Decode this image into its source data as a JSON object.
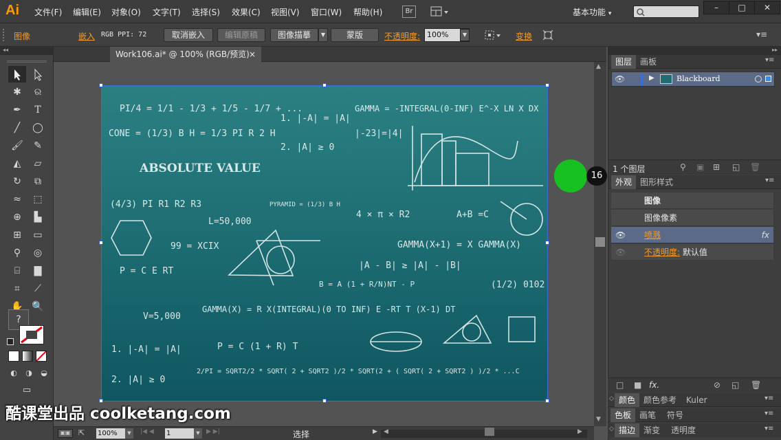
{
  "app": {
    "logo": "Ai",
    "menu": [
      "文件(F)",
      "编辑(E)",
      "对象(O)",
      "文字(T)",
      "选择(S)",
      "效果(C)",
      "视图(V)",
      "窗口(W)",
      "帮助(H)"
    ],
    "bridge_label": "Br",
    "workspace_label": "基本功能",
    "window_buttons": [
      "–",
      "□",
      "✕"
    ]
  },
  "control_bar": {
    "selection_type": "图像",
    "embed_label": "嵌入",
    "color_info": "RGB  PPI: 72",
    "unembed_button": "取消嵌入",
    "edit_original_button": "编辑原稿",
    "image_trace_button": "图像描摹",
    "mask_button": "蒙版",
    "opacity_label": "不透明度:",
    "opacity_value": "100%",
    "transform_label": "变换"
  },
  "document": {
    "tab_title": "Work106.ai* @ 100% (RGB/预览)",
    "tab_close": "×"
  },
  "artboard_text": {
    "l1": "PI/4 = 1/1 - 1/3 + 1/5 - 1/7 + ...",
    "l2": "1.  |-A| = |A|",
    "l3": "GAMMA = -INTEGRAL(0-INF) E^-X LN X DX",
    "l4": "CONE = (1/3) B H = 1/3 PI R 2 H",
    "l5": "|-23|=|4|",
    "l6": "2.  |A| ≥ 0",
    "l7": "ABSOLUTE VALUE",
    "l8": "(4/3) PI R1 R2 R3",
    "l9": "PYRAMID = (1/3) B H",
    "l10": "L=50,000",
    "l11": "4 × π × R2",
    "l12": "A+B =C",
    "l13": "99 = XCIX",
    "l14": "GAMMA(X+1) = X GAMMA(X)",
    "l15": "P = C E RT",
    "l16": "|A - B| ≥ |A| - |B|",
    "l17": "B = A (1 + R/N)NT - P",
    "l18": "(1/2) 0102",
    "l19": "V=5,000",
    "l20": "GAMMA(X) = R X(INTEGRAL)(0 TO INF) E -RT T (X-1) DT",
    "l21": "1.  |-A| = |A|",
    "l22": "P = C (1 + R) T",
    "l23": "2.  |A| ≥ 0",
    "l24": "2/PI = SQRT2/2 * SQRT( 2 + SQRT2 )/2 * SQRT(2 + ( SQRT( 2 + SQRT2 ) )/2 * ...C"
  },
  "status_bar": {
    "zoom": "100%",
    "page": "1",
    "tool_status": "选择"
  },
  "overlay": {
    "step_number": "16",
    "watermark": "酷课堂出品 coolketang.com"
  },
  "layers_panel": {
    "tabs": [
      "图层",
      "画板"
    ],
    "layer_name": "Blackboard",
    "layer_count": "1 个图层"
  },
  "appearance_panel": {
    "tabs": [
      "外观",
      "图形样式"
    ],
    "title": "图像",
    "subtitle": "图像像素",
    "effect": "喷溅",
    "opacity_label": "不透明度:",
    "opacity_value": "默认值",
    "fx": "fx"
  },
  "bottom_panels": {
    "row1": [
      "颜色",
      "颜色参考",
      "Kuler"
    ],
    "row2": [
      "色板",
      "画笔",
      "符号"
    ],
    "row3": [
      "描边",
      "渐变",
      "透明度"
    ]
  },
  "colors": {
    "accent": "#f59a23",
    "highlight_dot": "#16c121",
    "selection": "#3a6fd8"
  }
}
